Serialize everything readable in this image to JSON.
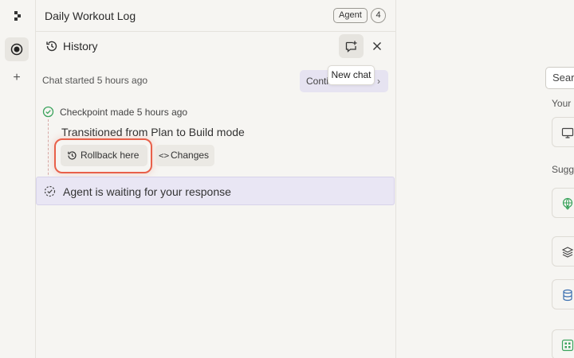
{
  "app": {
    "title": "Daily Workout Log",
    "agent_badge": "Agent",
    "notification_count": "4"
  },
  "history": {
    "title": "History",
    "new_chat_tooltip": "New chat",
    "chat_started": "Chat started 5 hours ago",
    "continue_label": "Conti",
    "checkpoint": {
      "label": "Checkpoint made 5 hours ago",
      "description": "Transitioned from Plan to Build mode",
      "rollback_label": "Rollback here",
      "changes_label": "Changes",
      "changes_glyph": "<>"
    },
    "status": "Agent is waiting for your response"
  },
  "right_panel": {
    "search_placeholder": "Sear",
    "your_label": "Your",
    "suggestions_label": "Sugg"
  },
  "colors": {
    "highlight_ring": "#e8604a",
    "status_bg": "#e9e6f4",
    "check_green": "#3aa35c"
  },
  "icons": [
    "logo-icon",
    "record-icon",
    "plus-icon",
    "history-icon",
    "new-chat-icon",
    "close-icon",
    "check-circle-icon",
    "rollback-icon",
    "code-icon",
    "waiting-icon",
    "monitor-icon",
    "globe-icon",
    "layers-icon",
    "database-icon",
    "grid-icon"
  ]
}
